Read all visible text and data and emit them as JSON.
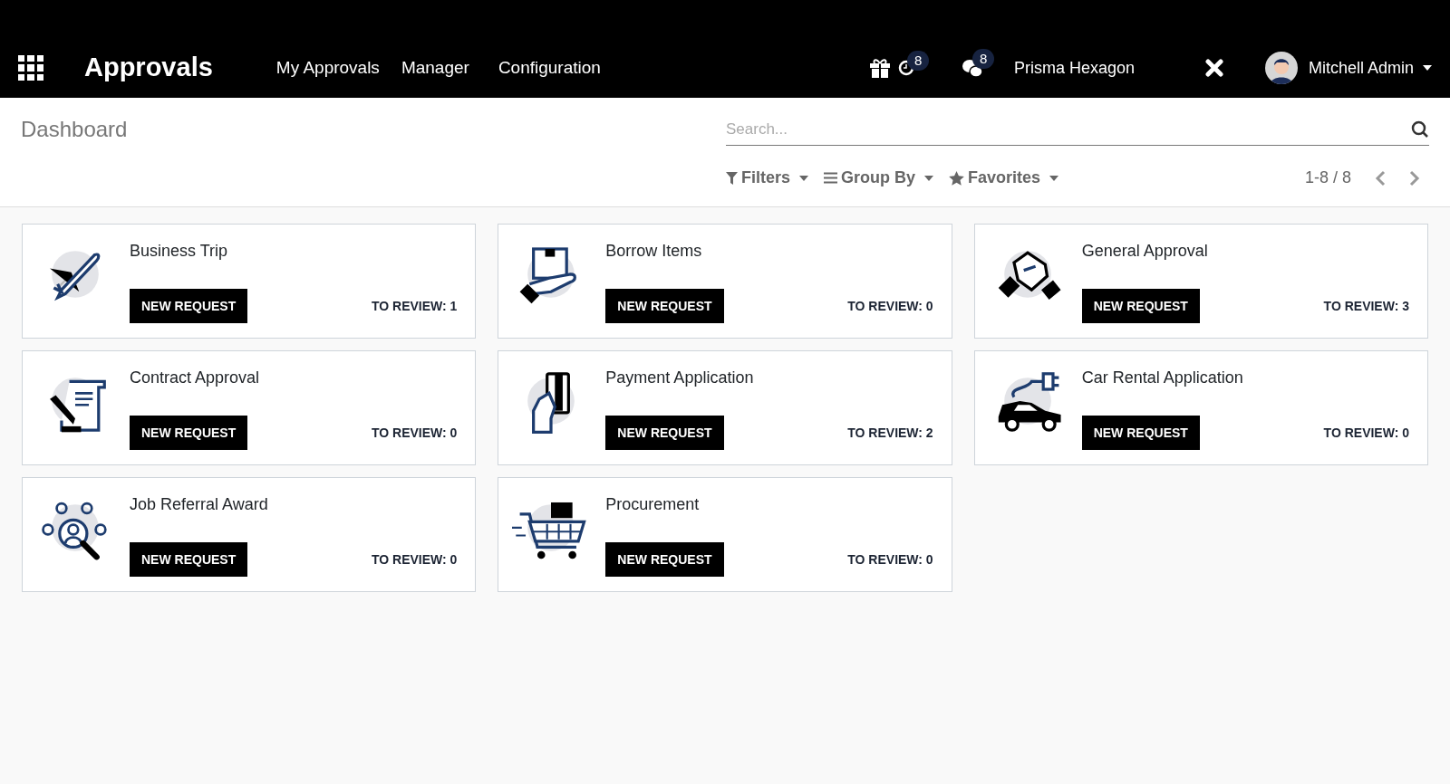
{
  "navbar": {
    "app_title": "Approvals",
    "menu": [
      "My Approvals",
      "Manager",
      "Configuration"
    ],
    "activity_count": "8",
    "messages_count": "8",
    "company": "Prisma Hexagon",
    "user": "Mitchell Admin"
  },
  "control_panel": {
    "breadcrumb": "Dashboard",
    "search": {
      "placeholder": "Search..."
    },
    "filters": "Filters",
    "group_by": "Group By",
    "favorites": "Favorites",
    "pager": "1-8 / 8"
  },
  "cards": [
    {
      "title": "Business Trip",
      "button": "NEW REQUEST",
      "to_review": "TO REVIEW: 1"
    },
    {
      "title": "Borrow Items",
      "button": "NEW REQUEST",
      "to_review": "TO REVIEW: 0"
    },
    {
      "title": "General Approval",
      "button": "NEW REQUEST",
      "to_review": "TO REVIEW: 3"
    },
    {
      "title": "Contract Approval",
      "button": "NEW REQUEST",
      "to_review": "TO REVIEW: 0"
    },
    {
      "title": "Payment Application",
      "button": "NEW REQUEST",
      "to_review": "TO REVIEW: 2"
    },
    {
      "title": "Car Rental Application",
      "button": "NEW REQUEST",
      "to_review": "TO REVIEW: 0"
    },
    {
      "title": "Job Referral Award",
      "button": "NEW REQUEST",
      "to_review": "TO REVIEW: 0"
    },
    {
      "title": "Procurement",
      "button": "NEW REQUEST",
      "to_review": "TO REVIEW: 0"
    }
  ]
}
